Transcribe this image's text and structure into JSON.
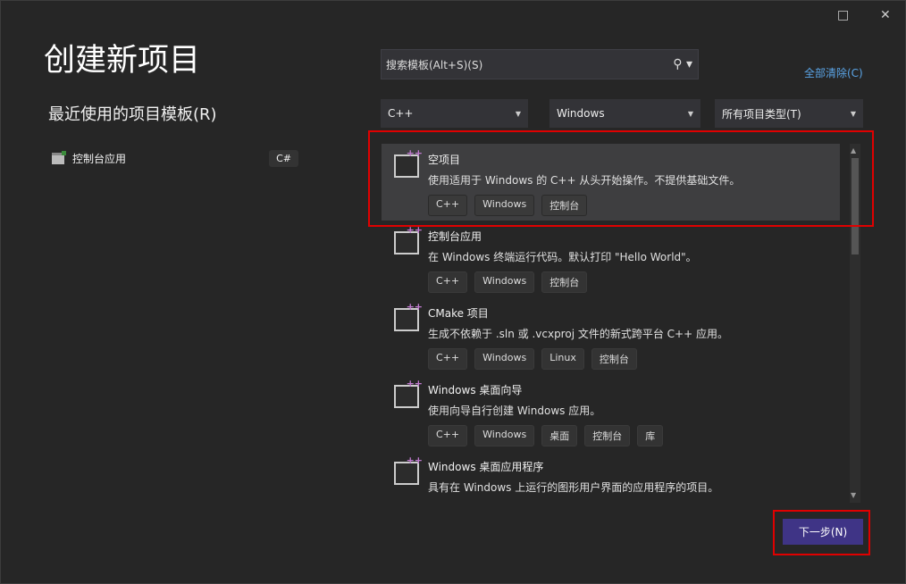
{
  "window": {
    "maximize_icon": "□",
    "close_icon": "✕"
  },
  "title": "创建新项目",
  "recent": {
    "heading": "最近使用的项目模板(R)",
    "items": [
      {
        "label": "控制台应用",
        "lang": "C#"
      }
    ]
  },
  "search": {
    "placeholder": "搜索模板(Alt+S)(S)",
    "icon": "🔍"
  },
  "clear_all": "全部清除(C)",
  "filters": [
    {
      "value": "C++"
    },
    {
      "value": "Windows"
    },
    {
      "value": "所有项目类型(T)"
    }
  ],
  "templates": [
    {
      "name": "空项目",
      "desc": "使用适用于 Windows 的 C++ 从头开始操作。不提供基础文件。",
      "tags": [
        "C++",
        "Windows",
        "控制台"
      ],
      "selected": true
    },
    {
      "name": "控制台应用",
      "desc": "在 Windows 终端运行代码。默认打印 \"Hello World\"。",
      "tags": [
        "C++",
        "Windows",
        "控制台"
      ]
    },
    {
      "name": "CMake 项目",
      "desc": "生成不依赖于 .sln 或 .vcxproj 文件的新式跨平台 C++ 应用。",
      "tags": [
        "C++",
        "Windows",
        "Linux",
        "控制台"
      ]
    },
    {
      "name": "Windows 桌面向导",
      "desc": "使用向导自行创建 Windows 应用。",
      "tags": [
        "C++",
        "Windows",
        "桌面",
        "控制台",
        "库"
      ]
    },
    {
      "name": "Windows 桌面应用程序",
      "desc": "具有在 Windows 上运行的图形用户界面的应用程序的项目。",
      "tags": []
    }
  ],
  "next_button": "下一步(N)",
  "colors": {
    "accent": "#3f3486",
    "highlight": "#e00000",
    "link": "#5aa4e6"
  }
}
